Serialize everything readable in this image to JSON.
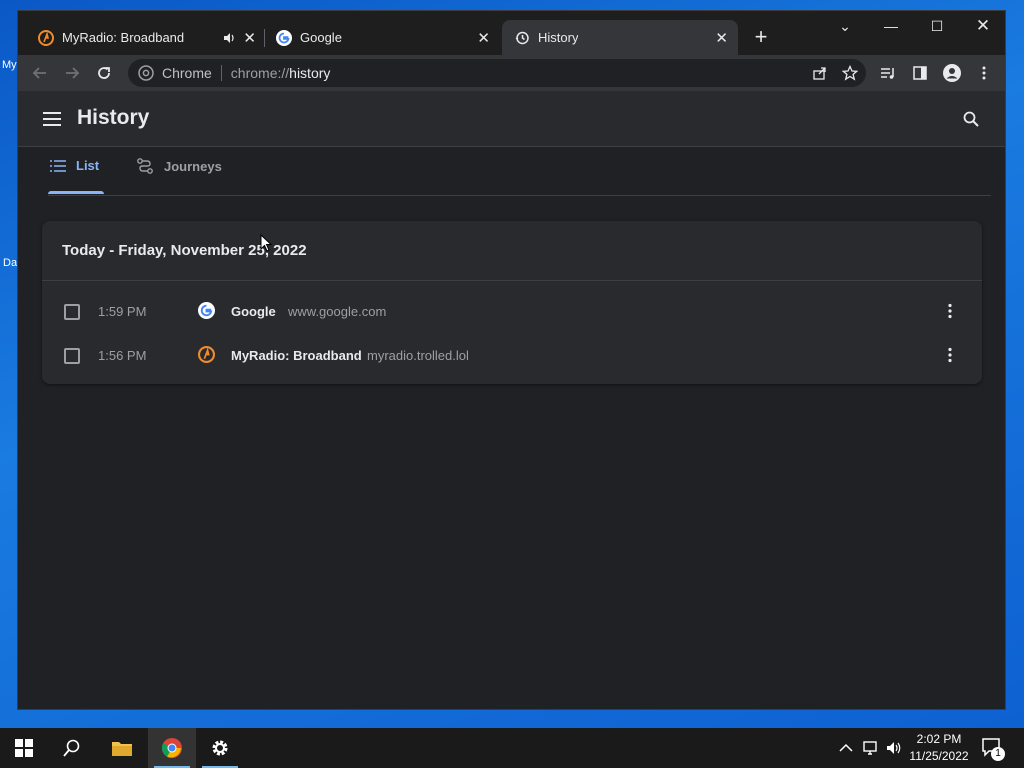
{
  "desktop": {
    "fragments": [
      "My",
      "Da"
    ]
  },
  "browser": {
    "tabs": [
      {
        "title": "MyRadio: Broadband",
        "favicon": "myradio-icon",
        "audio": true,
        "active": false
      },
      {
        "title": "Google",
        "favicon": "google-icon",
        "audio": false,
        "active": false
      },
      {
        "title": "History",
        "favicon": "history-icon",
        "audio": false,
        "active": true
      }
    ],
    "omnibox": {
      "chip": "Chrome",
      "url_prefix": "chrome://",
      "url_main": "history"
    }
  },
  "history": {
    "title": "History",
    "tabs": [
      {
        "label": "List",
        "active": true
      },
      {
        "label": "Journeys",
        "active": false
      }
    ],
    "day_header": "Today - Friday, November 25, 2022",
    "entries": [
      {
        "time": "1:59 PM",
        "title": "Google",
        "domain": "www.google.com",
        "favicon": "google-icon"
      },
      {
        "time": "1:56 PM",
        "title": "MyRadio: Broadband",
        "domain": "myradio.trolled.lol",
        "favicon": "myradio-icon"
      }
    ]
  },
  "taskbar": {
    "clock_time": "2:02 PM",
    "clock_date": "11/25/2022",
    "notification_count": "1"
  },
  "colors": {
    "accent": "#8ab4f8",
    "page_bg": "#202124",
    "card_bg": "#292a2d"
  }
}
